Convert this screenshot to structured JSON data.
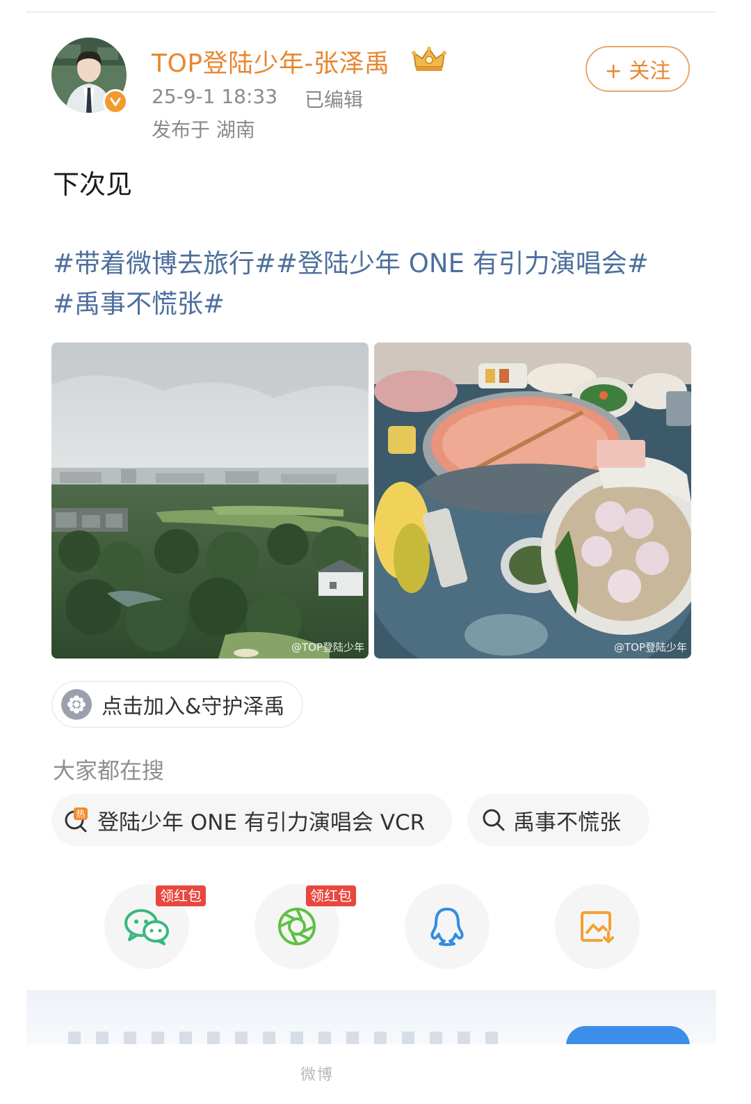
{
  "header": {
    "user_name": "TOP登陆少年-张泽禹",
    "post_time": "25-9-1 18:33",
    "edited": "已编辑",
    "location": "发布于 湖南",
    "follow_label": "+ 关注"
  },
  "post": {
    "text": "下次见",
    "topics": [
      "#带着微博去旅行#",
      "#登陆少年 ONE 有引力演唱会#",
      "#禹事不慌张#"
    ],
    "images": [
      {
        "watermark": "@TOP登陆少年"
      },
      {
        "watermark": "@TOP登陆少年"
      }
    ]
  },
  "super_topic": {
    "label": "点击加入&守护泽禹"
  },
  "search": {
    "title": "大家都在搜",
    "items": [
      {
        "label": "登陆少年 ONE 有引力演唱会 VCR",
        "icon": "hot-search-icon"
      },
      {
        "label": "禹事不慌张",
        "icon": "search-icon"
      }
    ]
  },
  "share": {
    "items": [
      {
        "name": "wechat",
        "badge": "领红包",
        "color": "#3ab77d"
      },
      {
        "name": "moments",
        "badge": "领红包",
        "color": "#5ec042"
      },
      {
        "name": "qq",
        "badge": "",
        "color": "#2f8de4"
      },
      {
        "name": "save-image",
        "badge": "",
        "color": "#f1a232"
      }
    ]
  },
  "footer": {
    "watermark": "微博"
  },
  "colors": {
    "accent": "#e8862f",
    "topic": "#4d6f9c",
    "badge_red": "#e8473d"
  }
}
